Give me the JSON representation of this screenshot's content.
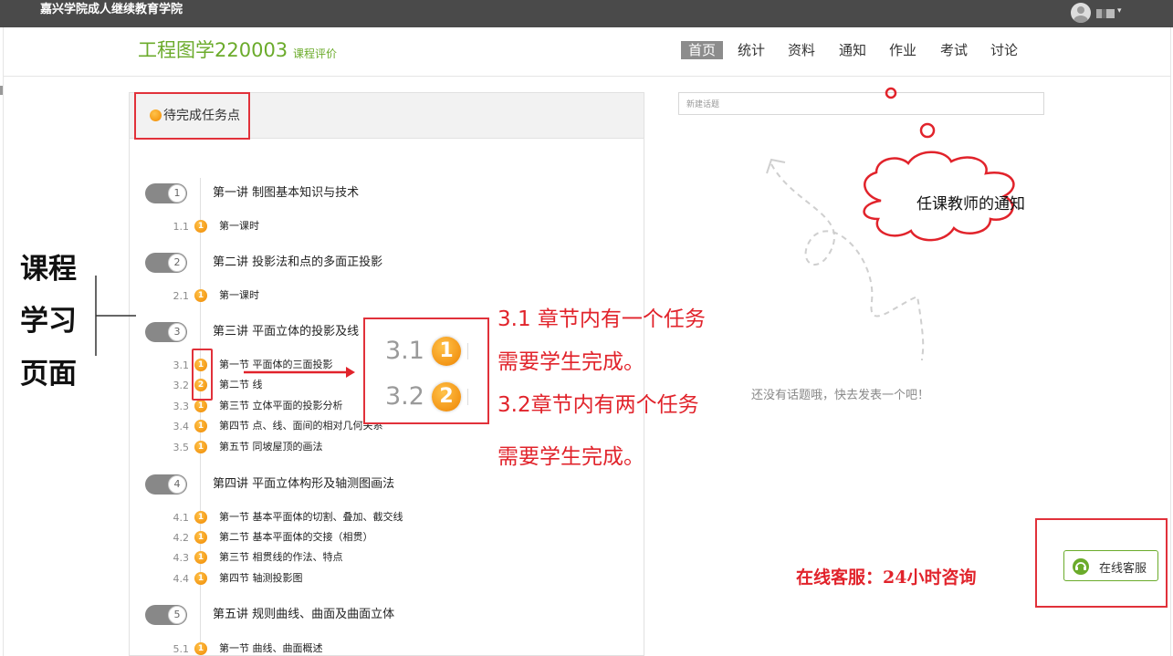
{
  "header": {
    "site_title": "嘉兴学院成人继续教育学院",
    "avatar_icon": "user-avatar-icon"
  },
  "course": {
    "title": "工程图学220003",
    "evaluation_link": "课程评价"
  },
  "nav": {
    "items": [
      "首页",
      "统计",
      "资料",
      "通知",
      "作业",
      "考试",
      "讨论"
    ],
    "active": "首页"
  },
  "left_panel": {
    "pending_label": "待完成任务点"
  },
  "lectures": [
    {
      "num": "1",
      "title": "第一讲 制图基本知识与技术",
      "sections": [
        {
          "num": "1.1",
          "badge": "1",
          "title": "第一课时"
        }
      ]
    },
    {
      "num": "2",
      "title": "第二讲 投影法和点的多面正投影",
      "sections": [
        {
          "num": "2.1",
          "badge": "1",
          "title": "第一课时"
        }
      ]
    },
    {
      "num": "3",
      "title": "第三讲 平面立体的投影及线",
      "sections": [
        {
          "num": "3.1",
          "badge": "1",
          "title": "第一节 平面体的三面投影"
        },
        {
          "num": "3.2",
          "badge": "2",
          "title": "第二节 线"
        },
        {
          "num": "3.3",
          "badge": "1",
          "title": "第三节 立体平面的投影分析"
        },
        {
          "num": "3.4",
          "badge": "1",
          "title": "第四节 点、线、面间的相对几何关系"
        },
        {
          "num": "3.5",
          "badge": "1",
          "title": "第五节 同坡屋顶的画法"
        }
      ]
    },
    {
      "num": "4",
      "title": "第四讲 平面立体构形及轴测图画法",
      "sections": [
        {
          "num": "4.1",
          "badge": "1",
          "title": "第一节 基本平面体的切割、叠加、截交线"
        },
        {
          "num": "4.2",
          "badge": "1",
          "title": "第二节 基本平面体的交接（相贯）"
        },
        {
          "num": "4.3",
          "badge": "1",
          "title": "第三节 相贯线的作法、特点"
        },
        {
          "num": "4.4",
          "badge": "1",
          "title": "第四节 轴测投影图"
        }
      ]
    },
    {
      "num": "5",
      "title": "第五讲 规则曲线、曲面及曲面立体",
      "sections": [
        {
          "num": "5.1",
          "badge": "1",
          "title": "第一节 曲线、曲面概述"
        }
      ]
    }
  ],
  "zoom": {
    "rows": [
      {
        "num": "3.1",
        "badge": "1"
      },
      {
        "num": "3.2",
        "badge": "2"
      }
    ]
  },
  "annotations": {
    "side_label_lines": [
      "课程",
      "学习",
      "页面"
    ],
    "note_lines": [
      "3.1 章节内有一个任务",
      "需要学生完成。",
      "3.2章节内有两个任务",
      "需要学生完成。"
    ],
    "cloud_text": "任课教师的通知",
    "service_note": "在线客服：24小时咨询"
  },
  "discussion": {
    "input_placeholder": "新建话题",
    "empty_message": "还没有话题哦，快去发表一个吧！"
  },
  "service": {
    "button_label": "在线客服",
    "icon": "headset-icon"
  },
  "colors": {
    "accent_green": "#6bab2b",
    "annotation_red": "#e1313a",
    "badge_orange": "#f08a00",
    "topbar": "#4a4a4a"
  }
}
